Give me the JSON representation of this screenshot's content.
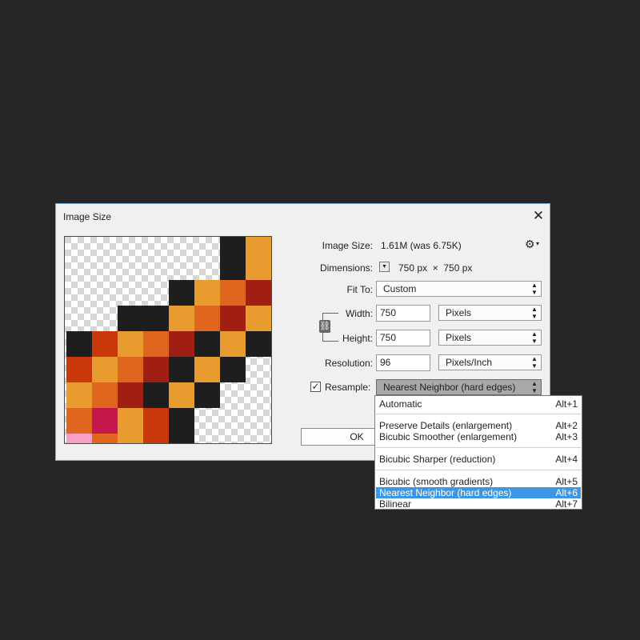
{
  "dialog": {
    "title": "Image Size",
    "close_glyph": "✕",
    "image_size_label": "Image Size:",
    "image_size_value": "1.61M (was 6.75K)",
    "gear_glyph": "⚙",
    "dimensions_label": "Dimensions:",
    "dimensions_value": "750 px  ×  750 px",
    "fit_to_label": "Fit To:",
    "fit_to_value": "Custom",
    "width_label": "Width:",
    "width_value": "750",
    "width_unit": "Pixels",
    "height_label": "Height:",
    "height_value": "750",
    "height_unit": "Pixels",
    "resolution_label": "Resolution:",
    "resolution_value": "96",
    "resolution_unit": "Pixels/Inch",
    "resample_label": "Resample:",
    "resample_checked": true,
    "resample_value": "Nearest Neighbor (hard edges)",
    "ok_label": "OK"
  },
  "resample_menu": [
    {
      "label": "Automatic",
      "shortcut": "Alt+1",
      "highlighted": false
    },
    {
      "label": "Preserve Details (enlargement)",
      "shortcut": "Alt+2",
      "highlighted": false
    },
    {
      "label": "Bicubic Smoother (enlargement)",
      "shortcut": "Alt+3",
      "highlighted": false
    },
    {
      "label": "Bicubic Sharper (reduction)",
      "shortcut": "Alt+4",
      "highlighted": false
    },
    {
      "label": "Bicubic (smooth gradients)",
      "shortcut": "Alt+5",
      "highlighted": false
    },
    {
      "label": "Nearest Neighbor (hard edges)",
      "shortcut": "Alt+6",
      "highlighted": true
    },
    {
      "label": "Bilinear",
      "shortcut": "Alt+7",
      "highlighted": false
    }
  ],
  "preview": {
    "palette": {
      "K": "#1e1e1e",
      "Y": "#e89b2e",
      "O": "#e0661f",
      "R": "#a01f12",
      "E": "#c8380a",
      "M": "#c4184a",
      "P": "#f6a0c8"
    },
    "rows": [
      "......KYOR",
      "......KYOR",
      "....KYORO",
      "..KKYORY",
      "KEYORKYK",
      "EYORKYK.",
      "YORKYK..",
      "OMYEK...",
      "POYEK..."
    ]
  }
}
